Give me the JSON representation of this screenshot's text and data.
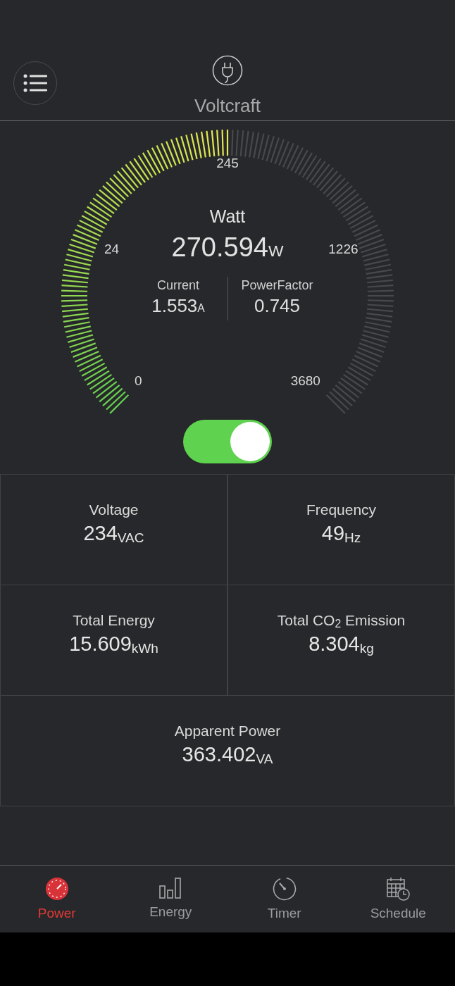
{
  "header": {
    "title": "Voltcraft"
  },
  "gauge": {
    "scale_labels": [
      "0",
      "24",
      "245",
      "1226",
      "3680"
    ],
    "title": "Watt",
    "value": "270.594",
    "unit": "W",
    "readings": [
      {
        "label": "Current",
        "value": "1.553",
        "unit": "A"
      },
      {
        "label": "PowerFactor",
        "value": "0.745"
      }
    ]
  },
  "power_switch": {
    "on": true
  },
  "stats": [
    {
      "label": "Voltage",
      "value": "234",
      "unit": "VAC"
    },
    {
      "label": "Frequency",
      "value": "49",
      "unit": "Hz"
    },
    {
      "label": "Total Energy",
      "value": "15.609",
      "unit": "kWh"
    },
    {
      "label": "Total CO$_{2}$ Emission",
      "value": "8.304",
      "unit": "kg"
    },
    {
      "label": "Apparent Power",
      "value": "363.402",
      "unit": "VA"
    }
  ],
  "nav": [
    {
      "kind": "power",
      "label": "Power",
      "selected": true
    },
    {
      "kind": "energy",
      "label": "Energy",
      "selected": false
    },
    {
      "kind": "timer",
      "label": "Timer",
      "selected": false
    },
    {
      "kind": "schedule",
      "label": "Schedule",
      "selected": false
    }
  ]
}
